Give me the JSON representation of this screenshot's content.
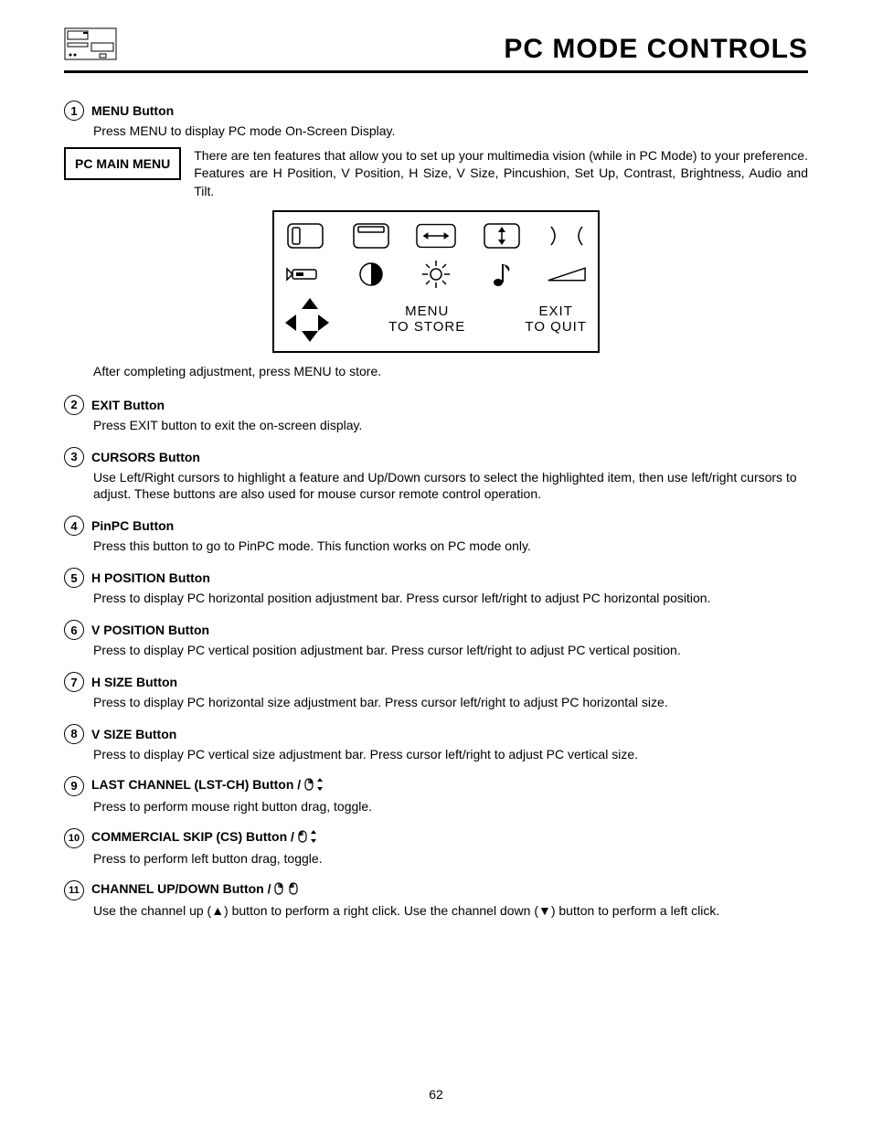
{
  "header": {
    "title": "PC MODE CONTROLS"
  },
  "pcMainMenu": {
    "boxLabel": "PC MAIN MENU",
    "description": "There are ten features that allow you to set up your multimedia vision (while in PC Mode) to your preference. Features are H Position, V Position, H Size, V Size, Pincushion, Set Up, Contrast, Brightness, Audio and Tilt."
  },
  "osd": {
    "menuLine1": "MENU",
    "menuLine2": "TO STORE",
    "exitLine1": "EXIT",
    "exitLine2": "TO QUIT"
  },
  "afterOsd": "After completing adjustment, press MENU to store.",
  "items": [
    {
      "num": "1",
      "title": "MENU Button",
      "body": "Press MENU to display PC mode On-Screen Display."
    },
    {
      "num": "2",
      "title": "EXIT Button",
      "body": "Press EXIT button to exit the on-screen display."
    },
    {
      "num": "3",
      "title": "CURSORS Button",
      "body": "Use Left/Right cursors to highlight a feature and Up/Down cursors to select the highlighted item, then use left/right cursors to adjust. These buttons are also used for mouse cursor remote control operation."
    },
    {
      "num": "4",
      "title": "PinPC Button",
      "body": "Press this button to go to PinPC mode.  This function works on PC mode only."
    },
    {
      "num": "5",
      "title": "H POSITION Button",
      "body": "Press to display PC horizontal position adjustment bar. Press cursor left/right to adjust PC horizontal position."
    },
    {
      "num": "6",
      "title": "V POSITION Button",
      "body": "Press to display PC vertical position adjustment bar. Press cursor left/right to adjust PC vertical position."
    },
    {
      "num": "7",
      "title": "H SIZE Button",
      "body": "Press to display PC horizontal size adjustment bar. Press cursor left/right to adjust PC horizontal size."
    },
    {
      "num": "8",
      "title": "V SIZE Button",
      "body": "Press to display PC vertical size adjustment bar. Press cursor left/right to adjust PC vertical size."
    },
    {
      "num": "9",
      "title": "LAST CHANNEL (LST-CH) Button / ",
      "body": "Press to perform mouse right button drag, toggle."
    },
    {
      "num": "10",
      "title": "COMMERCIAL SKIP (CS) Button / ",
      "body": "Press to perform left button drag, toggle."
    },
    {
      "num": "11",
      "title": "CHANNEL UP/DOWN Button / ",
      "body": "Use the channel up (▲) button to perform a right click. Use the channel down (▼) button to perform a left click."
    }
  ],
  "pageNumber": "62"
}
